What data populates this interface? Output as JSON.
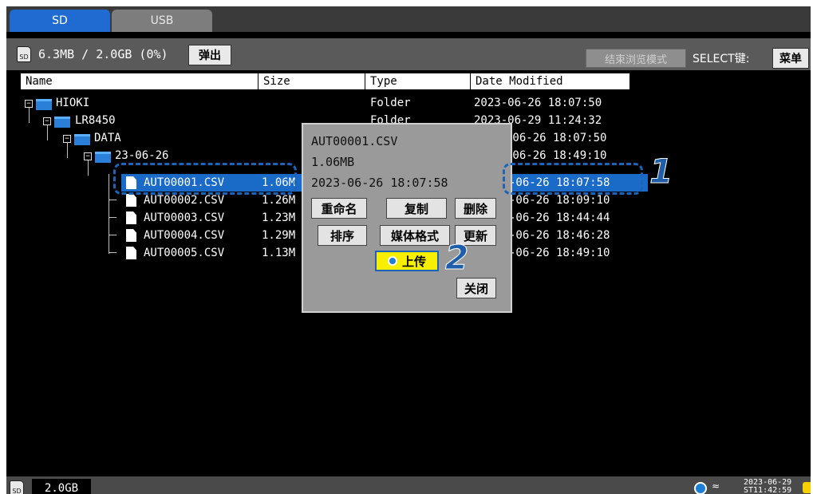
{
  "tabs": [
    {
      "label": "SD"
    },
    {
      "label": "USB"
    }
  ],
  "storage": {
    "summary": "6.3MB / 2.0GB (0%)",
    "eject_label": "弹出"
  },
  "toolbar": {
    "exit_browse_label": "结束浏览模式",
    "select_key_label": "SELECT键:",
    "menu_label": "菜单"
  },
  "columns": [
    "Name",
    "Size",
    "Type",
    "Date Modified"
  ],
  "rows": [
    {
      "name": "HIOKI",
      "size": "",
      "type": "Folder",
      "date": "2023-06-26 18:07:50"
    },
    {
      "name": "LR8450",
      "size": "",
      "type": "Folder",
      "date": "2023-06-29 11:24:32"
    },
    {
      "name": "DATA",
      "size": "",
      "type": "",
      "date": "-06-26 18:07:50"
    },
    {
      "name": "23-06-26",
      "size": "",
      "type": "",
      "date": "-06-26 18:49:10"
    },
    {
      "name": "AUT00001.CSV",
      "size": "1.06M",
      "type": "",
      "date": "-06-26 18:07:58"
    },
    {
      "name": "AUT00002.CSV",
      "size": "1.26M",
      "type": "",
      "date": "-06-26 18:09:10"
    },
    {
      "name": "AUT00003.CSV",
      "size": "1.23M",
      "type": "",
      "date": "-06-26 18:44:44"
    },
    {
      "name": "AUT00004.CSV",
      "size": "1.29M",
      "type": "",
      "date": "-06-26 18:46:28"
    },
    {
      "name": "AUT00005.CSV",
      "size": "1.13M",
      "type": "",
      "date": "-06-26 18:49:10"
    }
  ],
  "menu": {
    "file_name": "AUT00001.CSV",
    "file_size": "1.06MB",
    "file_date": "2023-06-26 18:07:58",
    "rename": "重命名",
    "copy": "复制",
    "delete": "删除",
    "sort": "排序",
    "format": "媒体格式",
    "update": "更新",
    "upload": "上传",
    "close": "关闭"
  },
  "callouts": {
    "one": "1",
    "two": "2"
  },
  "status": {
    "capacity": "2.0GB",
    "date": "2023-06-29",
    "time": "ST11:42:59"
  },
  "colors": {
    "accent": "#1f6bd1",
    "selection": "#1a6ac8",
    "upload": "#f6f000",
    "callout": "#1d64b8"
  }
}
